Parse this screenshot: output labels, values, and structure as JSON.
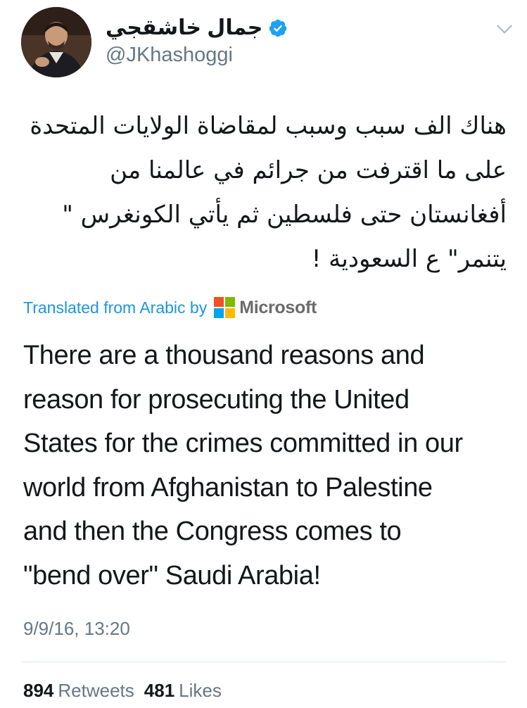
{
  "tweet": {
    "author": {
      "display_name": "جمال خاشقجي",
      "handle": "@JKhashoggi",
      "verified": true,
      "avatar_icon": "profile-photo"
    },
    "menu_icon": "chevron-down-icon",
    "arabic_lines": [
      "هناك الف سبب وسبب لمقاضاة الولايات المتحدة",
      "على ما اقترفت من جرائم في عالمنا من",
      "أفغانستان حتى فلسطين ثم يأتي الكونغرس \"",
      "يتنمر\" ع السعودية !"
    ],
    "translation": {
      "label": "Translated from Arabic by",
      "provider": "Microsoft",
      "logo_colors": [
        "#f25022",
        "#7fba00",
        "#00a4ef",
        "#ffb900"
      ]
    },
    "english_lines": [
      "There are a thousand reasons and",
      "reason for prosecuting the United",
      "States for the crimes committed in our",
      "world from Afghanistan to Palestine",
      "and then the Congress comes to",
      "\"bend over\" Saudi Arabia!"
    ],
    "timestamp": "9/9/16, 13:20",
    "stats": {
      "retweets_count": "894",
      "retweets_label": "Retweets",
      "likes_count": "481",
      "likes_label": "Likes"
    }
  },
  "colors": {
    "link": "#1b95e0",
    "secondary_text": "#657786",
    "verified_badge": "#1da1f2",
    "divider": "#e1e8ed"
  }
}
